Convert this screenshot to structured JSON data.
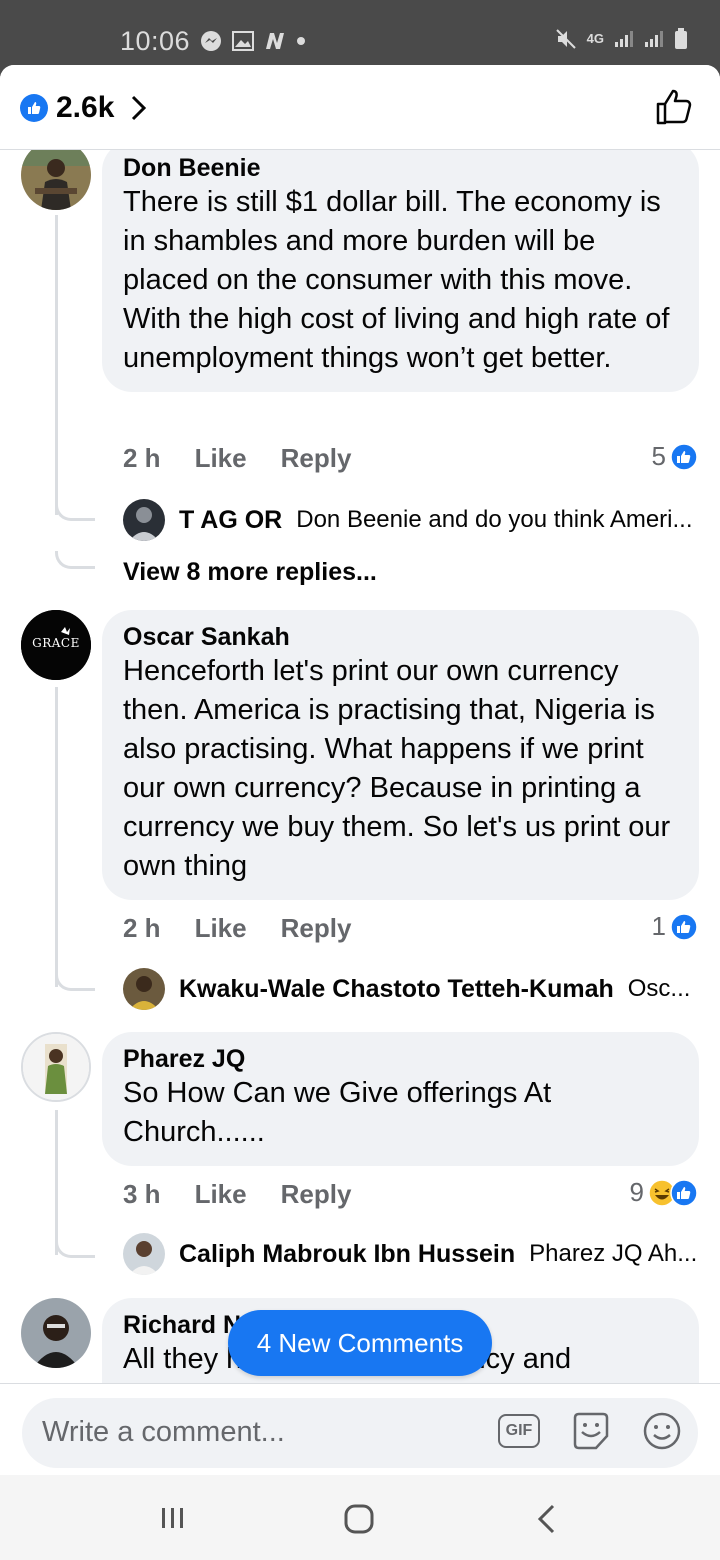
{
  "status_bar": {
    "time": "10:06",
    "network": "4G"
  },
  "header": {
    "like_count": "2.6k"
  },
  "comments": [
    {
      "author": "Don Beenie",
      "text": "There is still $1 dollar bill. The economy is in shambles and more burden will be placed on the consumer with this move. With the high cost of living and high rate of unemployment things won’t get better.",
      "time": "2 h",
      "like_label": "Like",
      "reply_label": "Reply",
      "reaction_count": "5",
      "reply_preview": {
        "name": "T AG OR",
        "snippet": "Don Beenie  and do you think Ameri..."
      },
      "view_more": "View 8 more replies..."
    },
    {
      "author": "Oscar Sankah",
      "avatar_text": "GRACE",
      "text": "Henceforth let's print our own currency then. America is practising that, Nigeria is also practising. What happens if we print our own currency? Because in printing a currency we buy them. So let's us print our own thing",
      "time": "2 h",
      "like_label": "Like",
      "reply_label": "Reply",
      "reaction_count": "1",
      "reply_preview": {
        "name": "Kwaku-Wale Chastoto Tetteh-Kumah",
        "snippet": "Osc..."
      }
    },
    {
      "author": "Pharez JQ",
      "text": "So How Can we Give offerings At Church......",
      "time": "3 h",
      "like_label": "Like",
      "reply_label": "Reply",
      "reaction_count": "9",
      "reply_preview": {
        "name": "Caliph Mabrouk Ibn Hussein",
        "snippet": "Pharez JQ Ah..."
      }
    },
    {
      "author": "Richard N",
      "text": "All they h         g         currency and"
    }
  ],
  "new_comments_button": "4 New Comments",
  "composer": {
    "placeholder": "Write a comment...",
    "gif_label": "GIF"
  },
  "colors": {
    "accent": "#1877f2",
    "bubble": "#f0f2f5",
    "secondary_text": "#65676b"
  }
}
